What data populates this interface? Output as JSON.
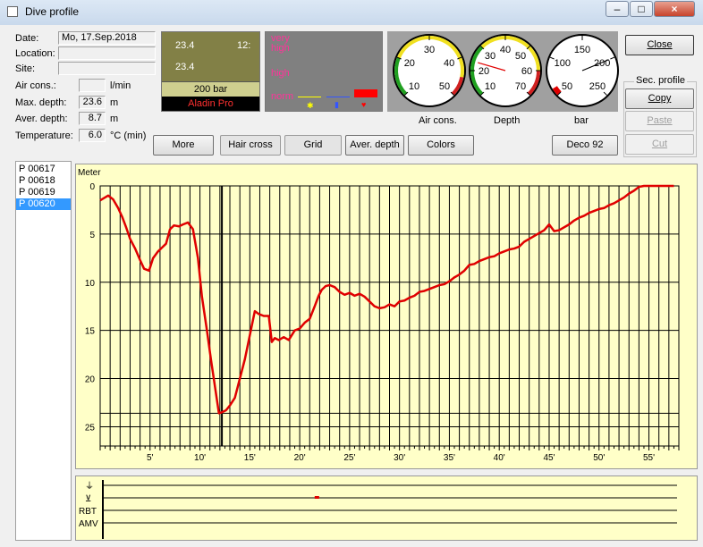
{
  "window": {
    "title": "Dive profile",
    "btn_min": "–",
    "btn_max": "□",
    "btn_close": "×"
  },
  "info": {
    "date_label": "Date:",
    "date_value": "Mo, 17.Sep.2018",
    "location_label": "Location:",
    "location_value": "",
    "site_label": "Site:",
    "site_value": "",
    "air_label": "Air cons.:",
    "air_value": "",
    "air_unit": "l/min",
    "maxdepth_label": "Max. depth:",
    "maxdepth_value": "23.6",
    "maxdepth_unit": "m",
    "averdepth_label": "Aver. depth:",
    "averdepth_value": "8.7",
    "averdepth_unit": "m",
    "temp_label": "Temperature:",
    "temp_value": "6.0",
    "temp_unit": "°C  (min)"
  },
  "computer": {
    "line1_left": "23.4",
    "line1_right": "12:",
    "line2": "23.4",
    "pressure": "200 bar",
    "model": "Aladin Pro"
  },
  "warnings": {
    "very_high": "very\nhigh",
    "high": "high",
    "norm": "norm",
    "colors": [
      "#ffff00",
      "#3355ff",
      "#ff0000"
    ]
  },
  "gauges": [
    {
      "caption": "Air cons.",
      "labels": [
        "10",
        "20",
        "30",
        "40",
        "50"
      ],
      "needle": 0
    },
    {
      "caption": "Depth",
      "labels": [
        "10",
        "20",
        "30",
        "40",
        "50",
        "60",
        "70"
      ],
      "needle": 23.6
    },
    {
      "caption": "bar",
      "labels": [
        "50",
        "100",
        "150",
        "200",
        "250"
      ],
      "needle": 200
    }
  ],
  "buttons": {
    "more": "More",
    "hair_cross": "Hair cross",
    "grid": "Grid",
    "aver_depth": "Aver. depth",
    "colors": "Colors",
    "deco": "Deco 92",
    "close": "Close",
    "sec_profile": "Sec. profile",
    "copy": "Copy",
    "paste": "Paste",
    "cut": "Cut"
  },
  "profiles": [
    "P 00617",
    "P 00618",
    "P 00619",
    "P 00620"
  ],
  "selected_profile": "P 00620",
  "strip": {
    "labels": [
      "RBT",
      "AMV"
    ],
    "marker_min": 21.5
  },
  "chart_data": {
    "type": "line",
    "ylabel": "Meter",
    "xlim": [
      0,
      58
    ],
    "ylim": [
      0,
      27
    ],
    "x_ticks": [
      "5'",
      "10'",
      "15'",
      "20'",
      "25'",
      "30'",
      "35'",
      "40'",
      "45'",
      "50'",
      "55'"
    ],
    "y_ticks": [
      "0",
      "5",
      "10",
      "15",
      "20",
      "25"
    ],
    "grid": true,
    "hair_cross_x": 12.2,
    "series": [
      {
        "color": "#e00000",
        "x": [
          0,
          0.8,
          1.3,
          1.8,
          2.2,
          2.6,
          3.0,
          3.5,
          4.0,
          4.4,
          4.9,
          5.3,
          5.8,
          6.2,
          6.6,
          7.0,
          7.4,
          7.9,
          8.3,
          8.8,
          9.3,
          9.8,
          10.2,
          10.7,
          11.1,
          11.6,
          11.9,
          12.2,
          12.6,
          13.0,
          13.5,
          14.0,
          14.5,
          15.0,
          15.5,
          15.9,
          16.4,
          16.9,
          17.2,
          17.5,
          17.9,
          18.4,
          18.9,
          19.5,
          20.0,
          20.5,
          21.0,
          21.5,
          21.9,
          22.2,
          22.6,
          23.0,
          23.5,
          24.0,
          24.5,
          25.0,
          25.5,
          26.0,
          26.5,
          27.0,
          27.5,
          28.0,
          28.5,
          29.0,
          29.5,
          30.0,
          30.5,
          31.0,
          31.5,
          32.0,
          32.5,
          33.0,
          33.5,
          34.0,
          34.5,
          35.0,
          35.5,
          36.0,
          36.5,
          37.0,
          37.5,
          38.0,
          38.5,
          39.0,
          39.5,
          40.0,
          40.5,
          41.0,
          41.5,
          42.0,
          42.5,
          43.0,
          43.5,
          44.0,
          44.5,
          45.0,
          45.5,
          46.0,
          46.5,
          47.0,
          47.5,
          48.0,
          48.5,
          49.0,
          49.5,
          50.0,
          50.5,
          51.0,
          51.5,
          52.0,
          52.5,
          53.0,
          53.5,
          54.0,
          54.5,
          55.0,
          55.5,
          56.0,
          56.5,
          57.0,
          57.5
        ],
        "y": [
          1.5,
          1.0,
          1.4,
          2.3,
          3.2,
          4.3,
          5.5,
          6.5,
          7.7,
          8.6,
          8.8,
          7.5,
          6.8,
          6.4,
          6.0,
          4.5,
          4.1,
          4.2,
          4.0,
          3.8,
          4.5,
          7.5,
          11.5,
          15.0,
          18.0,
          21.5,
          23.6,
          23.5,
          23.3,
          22.8,
          22.0,
          20.0,
          18.0,
          15.5,
          13.0,
          13.3,
          13.5,
          13.5,
          16.2,
          15.8,
          16.0,
          15.7,
          16.0,
          15.0,
          14.8,
          14.2,
          13.8,
          12.5,
          11.4,
          10.8,
          10.4,
          10.3,
          10.5,
          11.0,
          11.3,
          11.1,
          11.4,
          11.2,
          11.5,
          12.0,
          12.5,
          12.7,
          12.6,
          12.3,
          12.5,
          12.0,
          11.9,
          11.6,
          11.4,
          11.0,
          10.9,
          10.7,
          10.5,
          10.3,
          10.2,
          9.9,
          9.5,
          9.2,
          8.8,
          8.2,
          8.1,
          7.8,
          7.6,
          7.4,
          7.3,
          7.0,
          6.8,
          6.6,
          6.5,
          6.3,
          5.8,
          5.5,
          5.2,
          4.9,
          4.6,
          4.0,
          4.7,
          4.6,
          4.3,
          4.0,
          3.6,
          3.3,
          3.1,
          2.8,
          2.6,
          2.4,
          2.3,
          2.0,
          1.8,
          1.5,
          1.2,
          0.8,
          0.5,
          0.1,
          0.0,
          0.0,
          0.0,
          0.0,
          0.0,
          0.0,
          0.0
        ]
      }
    ]
  }
}
